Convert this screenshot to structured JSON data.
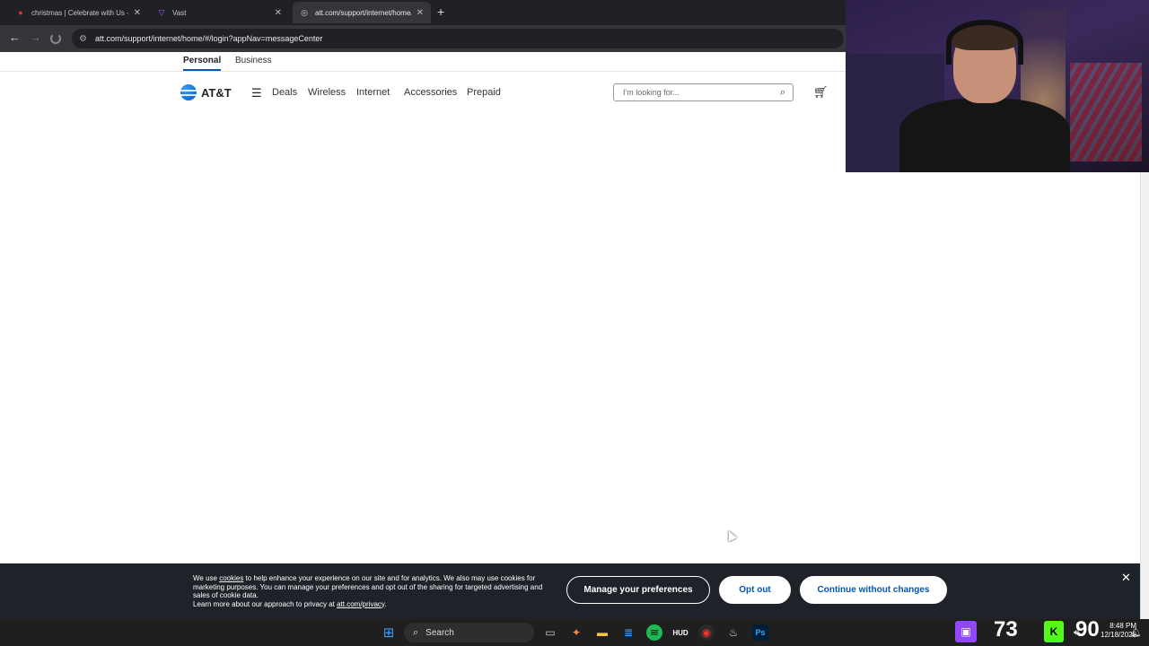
{
  "browser": {
    "tabs": [
      {
        "title": "christmas | Celebrate with Us -",
        "active": false
      },
      {
        "title": "Vast",
        "active": false
      },
      {
        "title": "att.com/support/internet/home/",
        "active": true
      }
    ],
    "url": "att.com/support/internet/home/#/login?appNav=messageCenter"
  },
  "att": {
    "segments": [
      "Personal",
      "Business"
    ],
    "logo_text": "AT&T",
    "nav": [
      "Deals",
      "Wireless",
      "Internet",
      "Accessories",
      "Prepaid"
    ],
    "search_placeholder": "I'm looking for...",
    "brand_color": "#0057b8"
  },
  "cookie_banner": {
    "text_pre": "We use ",
    "text_link": "cookies",
    "text_post": " to help enhance your experience on our site and for analytics. We also may use cookies for marketing purposes. You can manage your preferences and opt out of the sharing for targeted advertising and sales of cookie data.",
    "privacy_pre": "Learn more about our approach to privacy at ",
    "privacy_link": "att.com/privacy",
    "privacy_post": ".",
    "manage_label": "Manage your preferences",
    "optout_label": "Opt out",
    "continue_label": "Continue without changes"
  },
  "taskbar": {
    "search_label": "Search",
    "overlay_left": "73",
    "overlay_right": "90",
    "time": "8:48 PM",
    "date": "12/18/2025"
  }
}
